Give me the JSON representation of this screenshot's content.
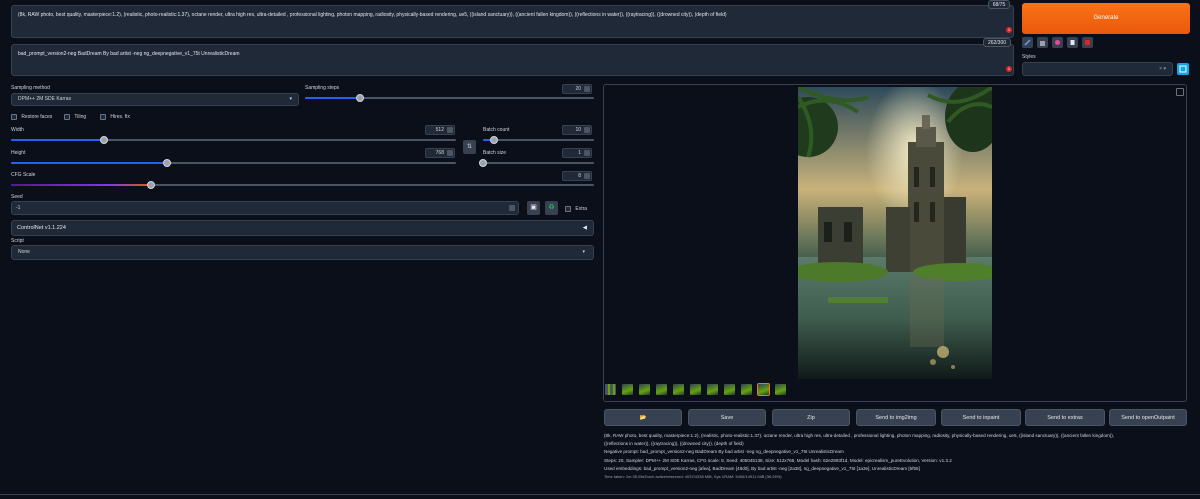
{
  "prompt": {
    "text": "(8k, RAW photo, best quality, masterpiece:1.2), (realistic, photo-realistic:1.37), octane render, ultra high res, ultra-detailed , professional lighting, photon mapping, radiosity, physically-based rendering, ue5, ((island sanctuary)), ((ancient fallen kingdom)), ((reflections in water)), ((raytracing)), ((drowned city)), (depth of field)",
    "counter": "68/75",
    "badge": "1"
  },
  "negative_prompt": {
    "text": "bad_prompt_version2-neg BadDream By bad artist -neg ng_deepnegative_v1_75t UnrealisticDream",
    "counter": "262/300",
    "badge": "1"
  },
  "generate": {
    "label": "Generate"
  },
  "styles": {
    "label": "Styles",
    "value": ""
  },
  "sampling": {
    "method_label": "Sampling method",
    "method_value": "DPM++ 2M SDE Karras",
    "steps_label": "Sampling steps",
    "steps_value": "20",
    "steps_fraction": 0.19
  },
  "checks": {
    "restore_faces": "Restore faces",
    "tiling": "Tiling",
    "hires_fix": "Hires. fix"
  },
  "width": {
    "label": "Width",
    "value": "512",
    "fraction": 0.21
  },
  "height": {
    "label": "Height",
    "value": "768",
    "fraction": 0.35
  },
  "batch_count": {
    "label": "Batch count",
    "value": "10",
    "fraction": 0.1
  },
  "batch_size": {
    "label": "Batch size",
    "value": "1",
    "fraction": 0.0
  },
  "cfg": {
    "label": "CFG Scale",
    "value": "8",
    "fraction": 0.24
  },
  "seed": {
    "label": "Seed",
    "value": "-1",
    "extra_label": "Extra"
  },
  "controlnet": {
    "label": "ControlNet v1.1.224",
    "arrow": "◀"
  },
  "script": {
    "label": "Script",
    "value": "None"
  },
  "actions": {
    "folder": "📂",
    "save": "Save",
    "zip": "Zip",
    "img2img": "Send to img2img",
    "inpaint": "Send to inpaint",
    "extras": "Send to extras",
    "openoutpaint": "Send to openOutpaint"
  },
  "info": {
    "line1": "(8k, RAW photo, best quality, masterpiece:1.2), (realistic, photo-realistic:1.37), octane render, ultra high res, ultra-detailed , professional lighting, photon mapping, radiosity, physically-based rendering, ue5, ((island sanctuary)), ((ancient fallen kingdom)),",
    "line2": "((reflections in water)), ((raytracing)), ((drowned city)), (depth of field)",
    "line3": "Negative prompt: bad_prompt_version2-neg BadDream By bad artist -neg ng_deepnegative_v1_75t UnrealisticDream",
    "line4": "Steps: 20, Sampler: DPM++ 2M SDE Karras, CFG scale: 8, Seed: 405045138, Size: 512x768, Model hash: 62e2993f1d, Model: epicrealism_pureEvolution, Version: v1.3.2",
    "line5": "Used embeddings: bad_prompt_version2-neg [afea], BadDream [48d0], By bad artist -neg [2a38], ng_deepnegative_v1_75t [1a3e], UnrealisticDream [5f55]",
    "line6": "Time taken: 1m 35.05sTorch active/reserved: 4037/4338 MiB, Sys VRAM: 5406/14911 MiB (36.26%)"
  },
  "colors": {
    "accent": "#ea580c",
    "slider": "#2563eb",
    "bg": "#0b0f19"
  }
}
